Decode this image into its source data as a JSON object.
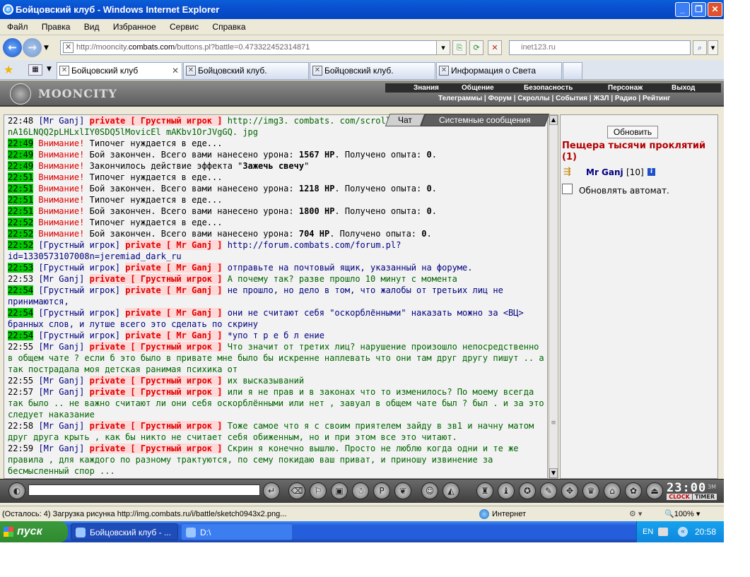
{
  "window": {
    "title": "Бойцовский клуб - Windows Internet Explorer"
  },
  "menu": [
    "Файл",
    "Правка",
    "Вид",
    "Избранное",
    "Сервис",
    "Справка"
  ],
  "address": {
    "url_prefix": "http://mooncity.",
    "url_domain": "combats.com",
    "url_suffix": "/buttons.pl?battle=0.473322452314871",
    "search": "inet123.ru"
  },
  "tabs": [
    {
      "label": "Бойцовский клуб",
      "close": "✕"
    },
    {
      "label": "Бойцовский клуб."
    },
    {
      "label": "Бойцовский клуб."
    },
    {
      "label": "Информация о Света"
    }
  ],
  "game": {
    "logo": "MOONCITY",
    "nav1": [
      "Знания",
      "Общение",
      "Безопасность",
      "Персонаж",
      "Выход"
    ],
    "nav2": "Телеграммы | Форум | Скроллы | События | ЖЗЛ | Радио | Рейтинг"
  },
  "chat_tabs": {
    "chat": "Чат",
    "system": "Системные сообщения"
  },
  "chat": [
    {
      "t": "22:48",
      "hl": false,
      "from": "[Mr Ganj]",
      "to": "private [ Грустный игрок ]",
      "msg": "http://img3. combats. com/scrolls/ nA16LNQQ2pLHLxlIY0SDQ5lMovicEl mAKbv1OrJVgGQ. jpg",
      "c": "g"
    },
    {
      "t": "22:49",
      "hl": true,
      "alert": "Внимание!",
      "sys": "Типочег нуждается в еде..."
    },
    {
      "t": "22:49",
      "hl": true,
      "alert": "Внимание!",
      "sys": "Бой закончен. Всего вами нанесено урона: ",
      "b1": "1567 HP",
      "sys2": ". Получено опыта: ",
      "b2": "0",
      "sys3": "."
    },
    {
      "t": "22:49",
      "hl": true,
      "alert": "Внимание!",
      "sys": "Закончилось действие эффекта \"",
      "b1": "Зажечь свечу",
      "sys2": "\""
    },
    {
      "t": "22:51",
      "hl": true,
      "alert": "Внимание!",
      "sys": "Типочег нуждается в еде..."
    },
    {
      "t": "22:51",
      "hl": true,
      "alert": "Внимание!",
      "sys": "Бой закончен. Всего вами нанесено урона: ",
      "b1": "1218 HP",
      "sys2": ". Получено опыта: ",
      "b2": "0",
      "sys3": "."
    },
    {
      "t": "22:51",
      "hl": true,
      "alert": "Внимание!",
      "sys": "Типочег нуждается в еде..."
    },
    {
      "t": "22:51",
      "hl": true,
      "alert": "Внимание!",
      "sys": "Бой закончен. Всего вами нанесено урона: ",
      "b1": "1800 HP",
      "sys2": ". Получено опыта: ",
      "b2": "0",
      "sys3": "."
    },
    {
      "t": "22:52",
      "hl": true,
      "alert": "Внимание!",
      "sys": "Типочег нуждается в еде..."
    },
    {
      "t": "22:52",
      "hl": true,
      "alert": "Внимание!",
      "sys": "Бой закончен. Всего вами нанесено урона: ",
      "b1": "704 HP",
      "sys2": ". Получено опыта: ",
      "b2": "0",
      "sys3": "."
    },
    {
      "t": "22:52",
      "hl": true,
      "from": "[Грустный игрок]",
      "to": "private [ Mr Ganj ]",
      "msg": "http://forum.combats.com/forum.pl? id=1330573107008n=jeremiad_dark_ru",
      "c": "b"
    },
    {
      "t": "22:53",
      "hl": true,
      "from": "[Грустный игрок]",
      "to": "private [ Mr Ganj ]",
      "msg": "отправьте на почтовый ящик, указанный на форуме.",
      "c": "b"
    },
    {
      "t": "22:53",
      "hl": false,
      "from": "[Mr Ganj]",
      "to": "private [ Грустный игрок ]",
      "msg": "А почему так? разве прошло 10 минут с момента",
      "c": "g"
    },
    {
      "t": "22:54",
      "hl": true,
      "from": "[Грустный игрок]",
      "to": "private [ Mr Ganj ]",
      "msg": "не прошло, но дело в том, что жалобы от третьих лиц не принимаются,",
      "c": "b"
    },
    {
      "t": "22:54",
      "hl": true,
      "from": "[Грустный игрок]",
      "to": "private [ Mr Ganj ]",
      "msg": "они не считают себя \"оскорблёнными\" наказать можно за <ВЦ> бранных слов, и лутше всего это сделать по скрину",
      "c": "b"
    },
    {
      "t": "22:54",
      "hl": true,
      "from": "[Грустный игрок]",
      "to": "private [ Mr Ganj ]",
      "msg": "*упо т р е б л ение",
      "c": "b"
    },
    {
      "t": "22:55",
      "hl": false,
      "from": "[Mr Ganj]",
      "to": "private [ Грустный игрок ]",
      "msg": "Что значит от третих лиц? нарушение произошло непосредственно в общем чате ? если б это было в привате мне было бы искренне наплевать что они там друг другу пишут .. а так пострадала моя детская ранимая психика от",
      "c": "g"
    },
    {
      "t": "22:55",
      "hl": false,
      "from": "[Mr Ganj]",
      "to": "private [ Грустный игрок ]",
      "msg": "их высказываний",
      "c": "g"
    },
    {
      "t": "22:57",
      "hl": false,
      "from": "[Mr Ganj]",
      "to": "private [ Грустный игрок ]",
      "msg": "или я не прав и в законах что то изменилось? По моему всегда так было .. не важно считают ли они себя оскорблёнными или нет , завуал в общем чате был ? был . и за это следует наказание",
      "c": "g"
    },
    {
      "t": "22:58",
      "hl": false,
      "from": "[Mr Ganj]",
      "to": "private [ Грустный игрок ]",
      "msg": "Тоже самое что я с своим приятелем зайду в зв1 и начну матом друг друга крыть , как бы никто не считает себя обиженным, но и при этом все это читают.",
      "c": "g"
    },
    {
      "t": "22:59",
      "hl": false,
      "from": "[Mr Ganj]",
      "to": "private [ Грустный игрок ]",
      "msg": "Скрин я конечно вышлю. Просто не люблю когда одни и те же правила , для каждого по разному трактуются, по сему покидаю ваш приват, и приношу извинение за бесмысленный спор ...",
      "c": "g"
    }
  ],
  "right": {
    "refresh": "Обновить",
    "location": "Пещера тысячи проклятий (1)",
    "player_name": "Mr Ganj",
    "player_level": "[10]",
    "info": "i",
    "auto_refresh": "Обновлять автомат."
  },
  "clock": {
    "time": "23:00",
    "mark": "3M",
    "clock_label": "CLOCK",
    "timer_label": "TIMER"
  },
  "status": {
    "text": "(Осталось: 4) Загрузка рисунка http://img.combats.ru/i/battle/sketch0943x2.png...",
    "zone": "Интернет",
    "zoom": "🔍100%  ▾"
  },
  "taskbar": {
    "start": "пуск",
    "tasks": [
      "Бойцовский клуб - ...",
      "D:\\"
    ],
    "lang": "EN",
    "time": "20:58"
  }
}
